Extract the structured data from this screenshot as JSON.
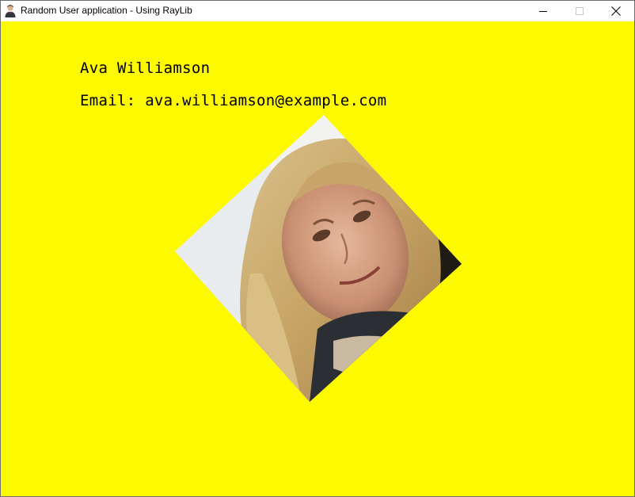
{
  "window": {
    "title": "Random User application - Using RayLib",
    "app_icon": "user-avatar-icon",
    "controls": {
      "minimize_icon": "minimize-icon",
      "maximize_icon": "maximize-icon",
      "close_icon": "close-icon"
    }
  },
  "canvas": {
    "background_color": "#fdf900"
  },
  "user": {
    "name": "Ava Williamson",
    "email_label": "Email:",
    "email": "ava.williamson@example.com",
    "photo_rotation_deg": 45,
    "photo_description_icon": "profile-photo"
  },
  "colors": {
    "text": "#000000",
    "background": "#fdf900"
  }
}
